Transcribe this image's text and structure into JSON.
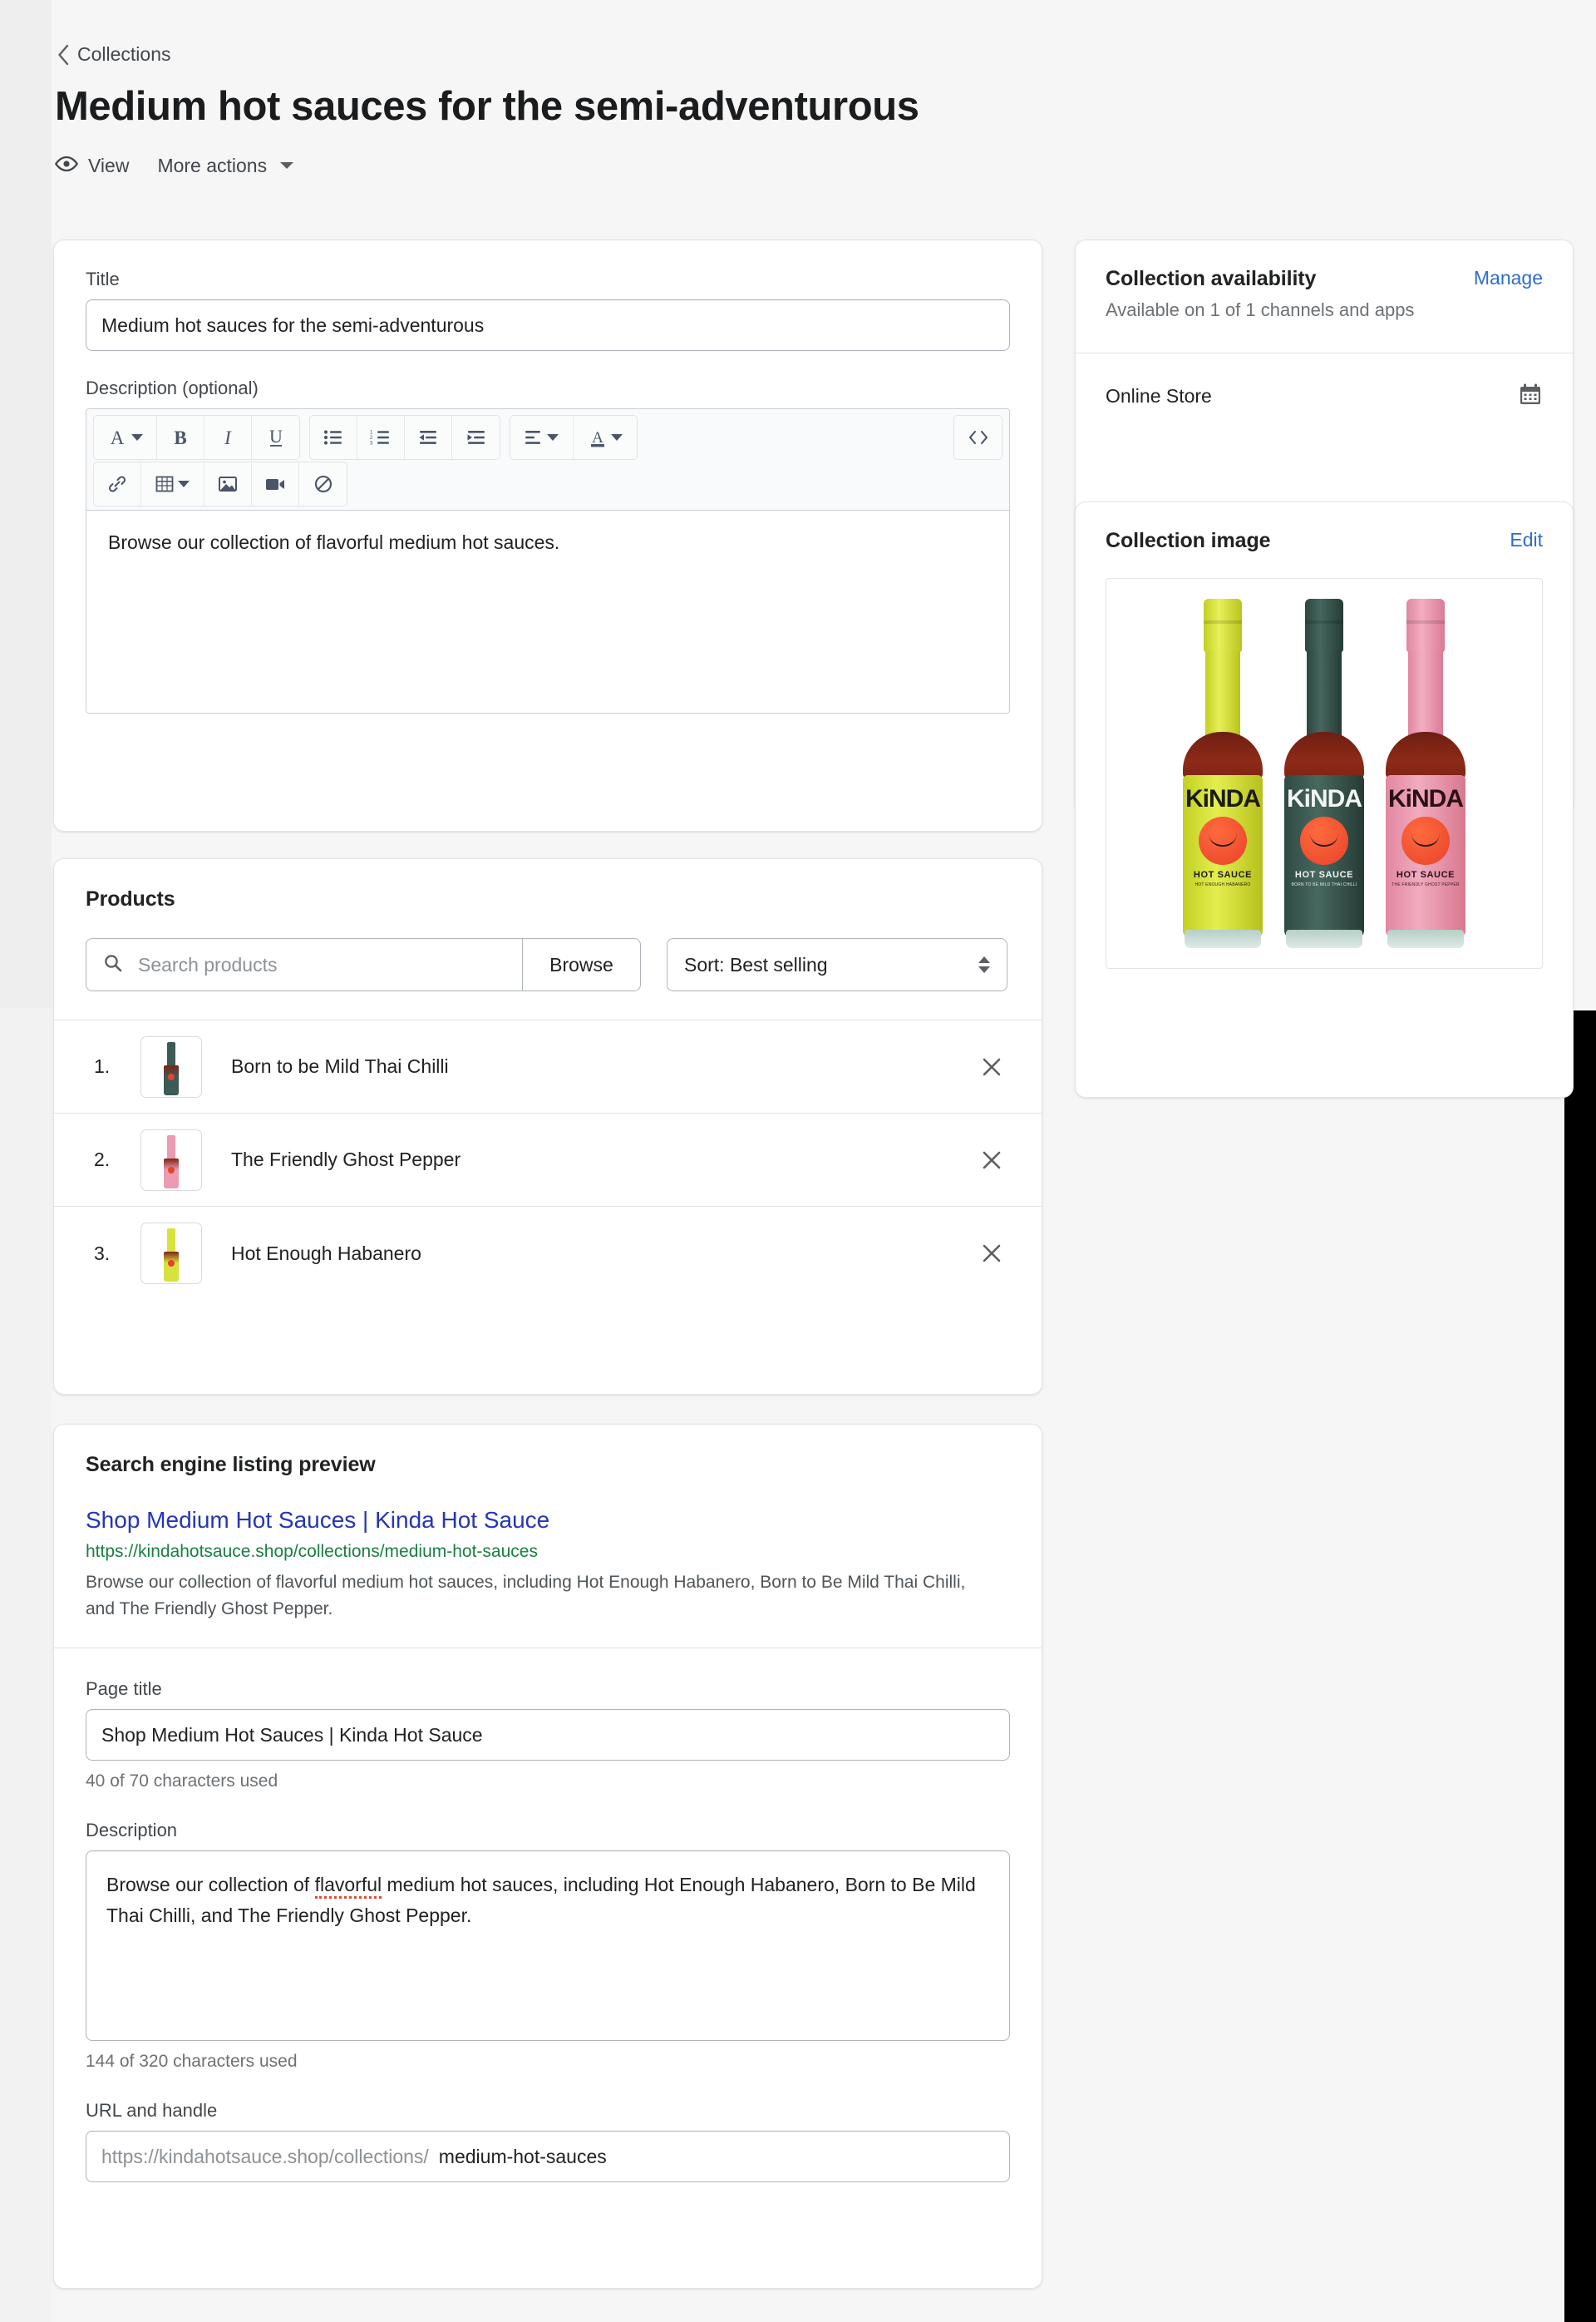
{
  "header": {
    "breadcrumb": "Collections",
    "title": "Medium hot sauces for the semi-adventurous",
    "view_label": "View",
    "more_actions_label": "More actions"
  },
  "details": {
    "title_label": "Title",
    "title_value": "Medium hot sauces for the semi-adventurous",
    "description_label": "Description (optional)",
    "description_value": "Browse our collection of flavorful medium hot sauces.",
    "toolbar": {
      "font_icon": "font-style-icon",
      "bold_icon": "bold-icon",
      "italic_icon": "italic-icon",
      "underline_icon": "underline-icon",
      "bulleted_list_icon": "bulleted-list-icon",
      "numbered_list_icon": "numbered-list-icon",
      "outdent_icon": "outdent-icon",
      "indent_icon": "indent-icon",
      "align_icon": "align-left-icon",
      "text_color_icon": "text-color-icon",
      "html_label": "<>",
      "link_icon": "link-icon",
      "table_icon": "table-icon",
      "image_icon": "image-icon",
      "video_icon": "video-icon",
      "clear_format_icon": "clear-formatting-icon"
    }
  },
  "products": {
    "title": "Products",
    "search_placeholder": "Search products",
    "search_value": "",
    "browse_label": "Browse",
    "sort_label": "Sort: Best selling",
    "items": [
      {
        "index": "1.",
        "name": "Born to be Mild Thai Chilli",
        "cap": "#3c5b54",
        "label": "#3c5b54",
        "remove_icon": "close-icon"
      },
      {
        "index": "2.",
        "name": "The Friendly Ghost Pepper",
        "cap": "#eb9bb2",
        "label": "#eb9bb2",
        "remove_icon": "close-icon"
      },
      {
        "index": "3.",
        "name": "Hot Enough Habanero",
        "cap": "#d8e23c",
        "label": "#d8e23c",
        "remove_icon": "close-icon"
      }
    ]
  },
  "seo": {
    "title": "Search engine listing preview",
    "preview_title": "Shop Medium Hot Sauces | Kinda Hot Sauce",
    "preview_url": "https://kindahotsauce.shop/collections/medium-hot-sauces",
    "preview_description": "Browse our collection of flavorful medium hot sauces, including Hot Enough Habanero, Born to Be Mild Thai Chilli, and The Friendly Ghost Pepper.",
    "page_title_label": "Page title",
    "page_title_value": "Shop Medium Hot Sauces | Kinda Hot Sauce",
    "page_title_counter": "40 of 70 characters used",
    "description_label": "Description",
    "description_value_pre": "Browse our collection of ",
    "description_value_misspelled": "flavorful",
    "description_value_post": " medium hot sauces, including Hot Enough Habanero, Born to Be Mild Thai Chilli, and The Friendly Ghost Pepper.",
    "description_counter": "144 of 320 characters used",
    "url_label": "URL and handle",
    "url_prefix": "https://kindahotsauce.shop/collections/",
    "url_handle": "medium-hot-sauces"
  },
  "availability": {
    "title": "Collection availability",
    "manage_label": "Manage",
    "subtitle": "Available on 1 of 1 channels and apps",
    "channel_name": "Online Store",
    "channel_icon": "calendar-icon"
  },
  "collection_image": {
    "title": "Collection image",
    "edit_label": "Edit",
    "bottles": [
      {
        "cap": "#d8e23c",
        "label": "#d8e23c",
        "brand": "KiNDA",
        "product": "HOT SAUCE",
        "flavor": "HOT ENOUGH HABANERO",
        "text_color": "#1b1b1b"
      },
      {
        "cap": "#3c5b54",
        "label": "#3c5b54",
        "brand": "KiNDA",
        "product": "HOT SAUCE",
        "flavor": "BORN TO BE MILD THAI CHILLI",
        "text_color": "#12211e"
      },
      {
        "cap": "#eb9bb2",
        "label": "#eb9bb2",
        "brand": "KiNDA",
        "product": "HOT SAUCE",
        "flavor": "THE FRIENDLY GHOST PEPPER",
        "text_color": "#2a1216"
      }
    ]
  },
  "colors": {
    "page_bg": "#f6f6f7",
    "card_bg": "#ffffff",
    "link": "#2c6ecb",
    "seo_title": "#2536b5",
    "seo_url": "#1a7e42",
    "text": "#202223",
    "subdued": "#6d7175"
  }
}
